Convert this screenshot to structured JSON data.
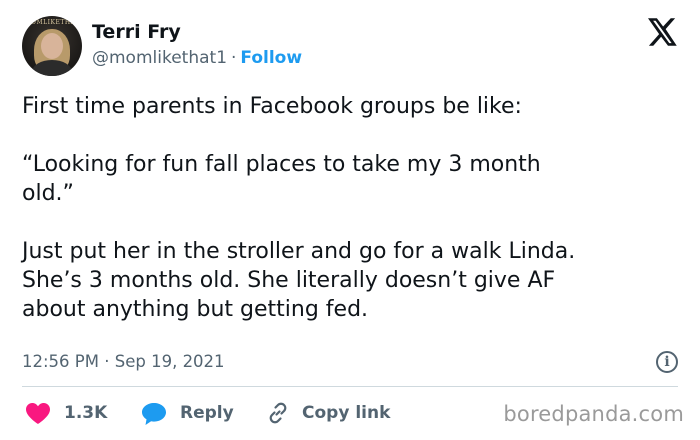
{
  "author": {
    "display_name": "Terri Fry",
    "handle": "@momlikethat1",
    "separator": "·",
    "follow_label": "Follow",
    "avatar_brand_text": "MOMLIKETHAT"
  },
  "tweet": {
    "lines_para1": [
      "First time parents in Facebook groups be like:"
    ],
    "lines_para2": [
      "“Looking for fun fall places to take my 3 month",
      "old.”"
    ],
    "lines_para3": [
      "Just put her in the stroller and go for a walk Linda.",
      "She’s 3 months old. She literally doesn’t give AF",
      "about anything but getting fed."
    ],
    "time": "12:56 PM",
    "meta_separator": "·",
    "date": "Sep 19, 2021",
    "info_icon": "info-icon"
  },
  "actions": {
    "likes": "1.3K",
    "reply_label": "Reply",
    "copy_label": "Copy link"
  },
  "watermark": "boredpanda.com",
  "colors": {
    "accent": "#1d9bf0",
    "heart": "#f91880",
    "text": "#0f1419",
    "secondary": "#536471"
  },
  "icons": {
    "platform": "x-logo-icon",
    "like": "heart-icon",
    "reply": "speech-bubble-icon",
    "copy": "link-icon"
  }
}
